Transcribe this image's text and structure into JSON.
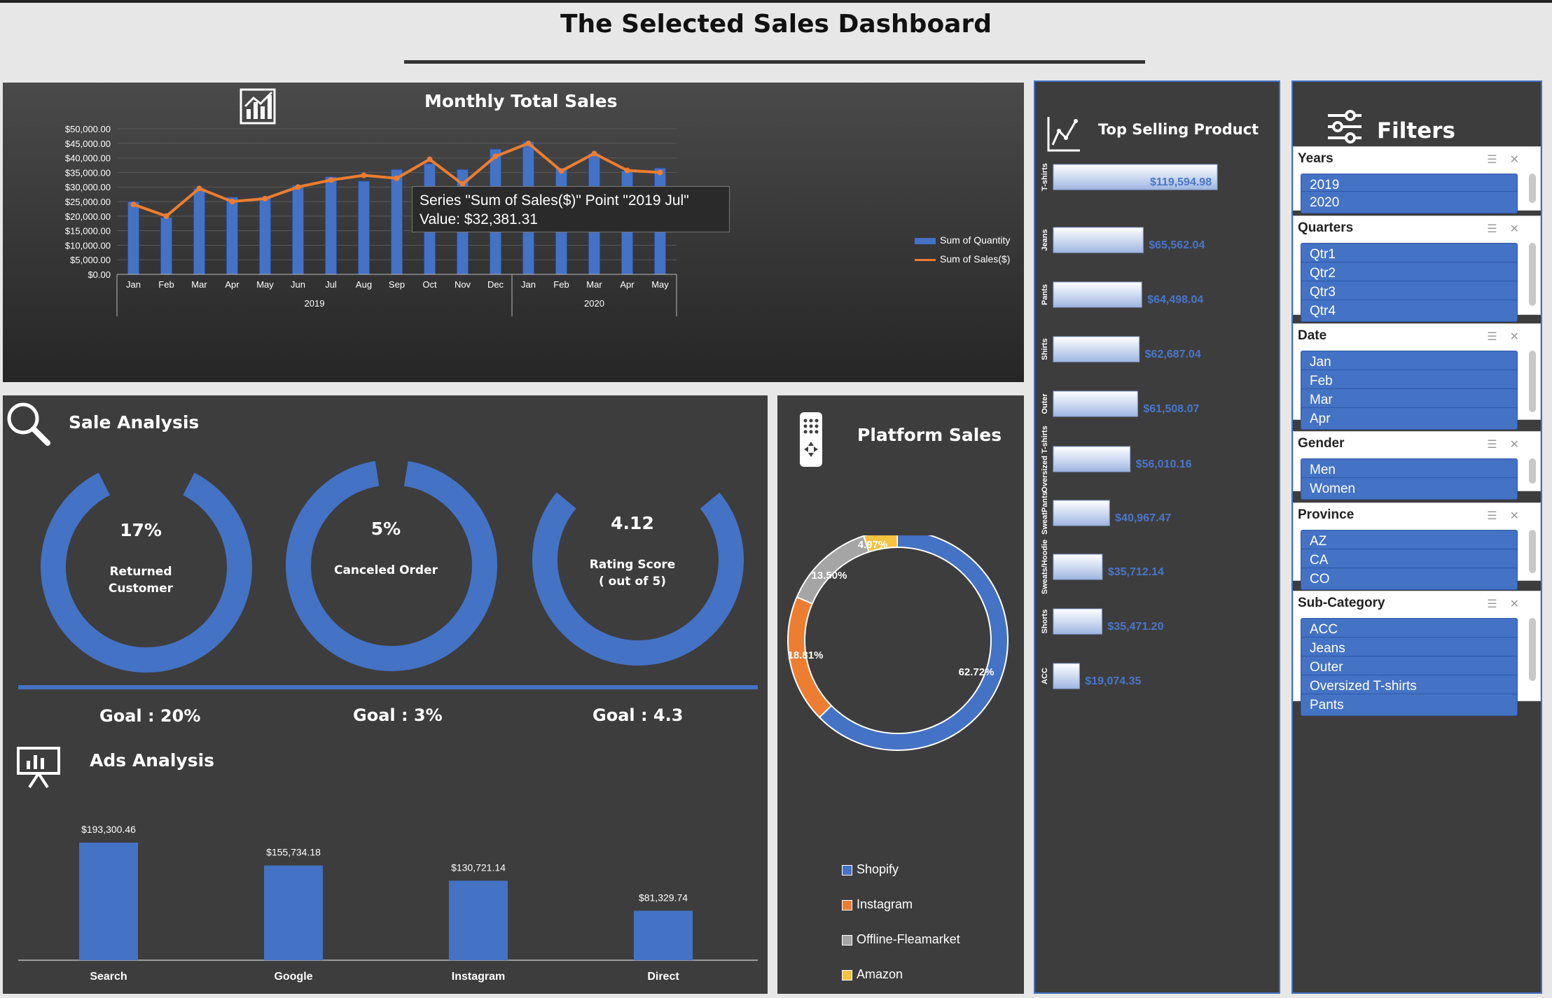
{
  "page_title": "The Selected Sales Dashboard",
  "monthly": {
    "title": "Monthly Total Sales",
    "icon": "bar-chart-icon",
    "tooltip_line1": "Series \"Sum of Sales($)\" Point \"2019 Jul\"",
    "tooltip_line2": "Value: $32,381.31",
    "legend": [
      "Sum of Quantity",
      "Sum of Sales($)"
    ]
  },
  "chart_data": [
    {
      "type": "bar",
      "title": "Monthly Total Sales",
      "categories": [
        "Jan",
        "Feb",
        "Mar",
        "Apr",
        "May",
        "Jun",
        "Jul",
        "Aug",
        "Sep",
        "Oct",
        "Nov",
        "Dec",
        "Jan",
        "Feb",
        "Mar",
        "Apr",
        "May"
      ],
      "groups": [
        {
          "label": "2019",
          "count": 12
        },
        {
          "label": "2020",
          "count": 5
        }
      ],
      "yticks": [
        "$50,000.00",
        "$45,000.00",
        "$40,000.00",
        "$35,000.00",
        "$30,000.00",
        "$25,000.00",
        "$20,000.00",
        "$15,000.00",
        "$10,000.00",
        "$5,000.00",
        "$0.00"
      ],
      "ylim": [
        0,
        50000
      ],
      "series": [
        {
          "name": "Sum of Quantity",
          "kind": "bar",
          "color": "#4472c4",
          "values": [
            25000,
            19500,
            29500,
            26500,
            26500,
            30500,
            33500,
            32000,
            36000,
            38000,
            36000,
            43000,
            45500,
            36500,
            41500,
            35500,
            36500
          ]
        },
        {
          "name": "Sum of Sales($)",
          "kind": "line",
          "color": "#ed7d31",
          "values": [
            24000,
            20000,
            29500,
            25000,
            26000,
            30000,
            32381.31,
            34000,
            33000,
            39500,
            31000,
            40500,
            45000,
            35500,
            41500,
            35700,
            35000
          ]
        }
      ]
    },
    {
      "type": "pie",
      "title": "Platform Sales",
      "labels": [
        "Shopify",
        "Instagram",
        "Offline-Fleamarket",
        "Amazon"
      ],
      "values": [
        62.72,
        18.81,
        13.5,
        4.97
      ],
      "value_labels": [
        "62.72%",
        "18.81%",
        "13.50%",
        "4.97%"
      ],
      "colors": [
        "#4472c4",
        "#ed7d31",
        "#a5a5a5",
        "#f6c242"
      ]
    },
    {
      "type": "bar",
      "title": "Top Selling Product",
      "orientation": "horizontal",
      "categories": [
        "T-shirts",
        "Jeans",
        "Pants",
        "Shirts",
        "Outer",
        "Oversized T-shirts",
        "SweatPants",
        "Sweats/Hoodie",
        "Shorts",
        "ACC"
      ],
      "values": [
        119594.98,
        65562.04,
        64498.04,
        62687.04,
        61508.07,
        56010.16,
        40967.47,
        35712.14,
        35471.2,
        19074.35
      ],
      "value_labels": [
        "$119,594.98",
        "$65,562.04",
        "$64,498.04",
        "$62,687.04",
        "$61,508.07",
        "$56,010.16",
        "$40,967.47",
        "$35,712.14",
        "$35,471.20",
        "$19,074.35"
      ]
    },
    {
      "type": "bar",
      "title": "Ads Analysis",
      "categories": [
        "Search",
        "Google",
        "Instagram",
        "Direct"
      ],
      "values": [
        193300.46,
        155734.18,
        130721.14,
        81329.74
      ],
      "value_labels": [
        "$193,300.46",
        "$155,734.18",
        "$130,721.14",
        "$81,329.74"
      ],
      "color": "#4472c4"
    }
  ],
  "sale_analysis": {
    "title": "Sale Analysis",
    "gauges": [
      {
        "value_text": "17%",
        "label1": "Returned",
        "label2": "Customer",
        "goal": "Goal : 20%",
        "fill": 0.85
      },
      {
        "value_text": "5%",
        "label1": "Canceled Order",
        "label2": "",
        "goal": "Goal : 3%",
        "fill": 0.95
      },
      {
        "value_text": "4.12",
        "label1": "Rating Score",
        "label2": "( out of 5)",
        "goal": "Goal : 4.3",
        "fill": 0.72
      }
    ]
  },
  "ads": {
    "title": "Ads Analysis"
  },
  "platform": {
    "title": "Platform Sales"
  },
  "top": {
    "title": "Top Selling Product"
  },
  "filters": {
    "title": "Filters",
    "slicers": [
      {
        "title": "Years",
        "items": [
          "2019",
          "2020"
        ]
      },
      {
        "title": "Quarters",
        "items": [
          "Qtr1",
          "Qtr2",
          "Qtr3",
          "Qtr4"
        ]
      },
      {
        "title": "Date",
        "items": [
          "Jan",
          "Feb",
          "Mar",
          "Apr"
        ]
      },
      {
        "title": "Gender",
        "items": [
          "Men",
          "Women"
        ]
      },
      {
        "title": "Province",
        "items": [
          "AZ",
          "CA",
          "CO"
        ]
      },
      {
        "title": "Sub-Category",
        "items": [
          "ACC",
          "Jeans",
          "Outer",
          "Oversized T-shirts",
          "Pants"
        ]
      }
    ]
  }
}
